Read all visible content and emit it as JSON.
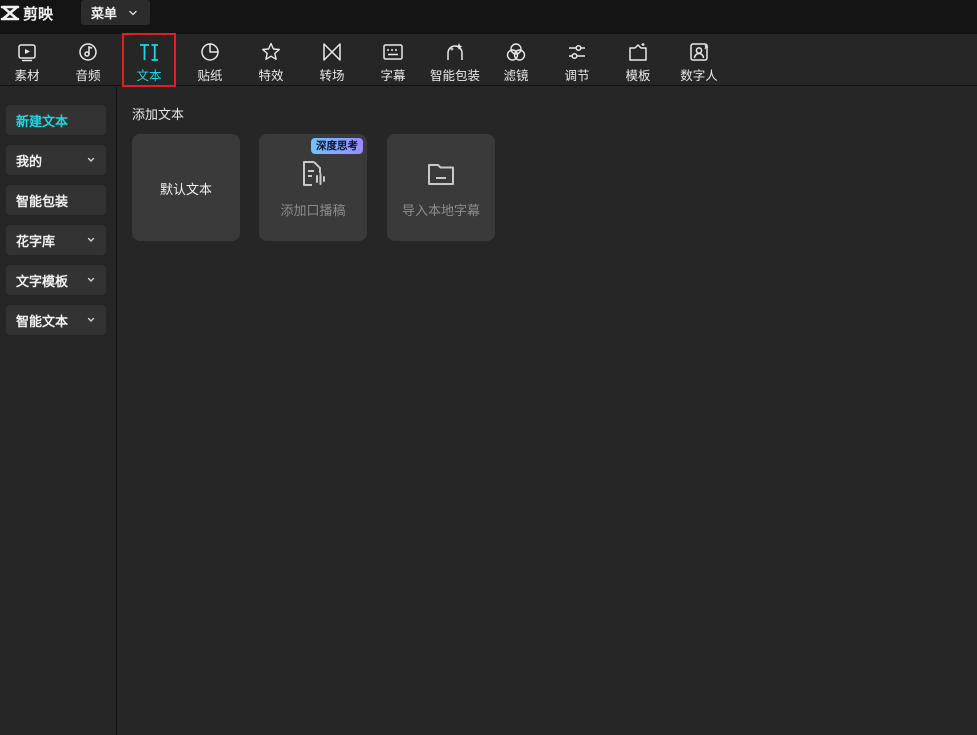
{
  "app": {
    "name": "剪映"
  },
  "menu": {
    "label": "菜单"
  },
  "toolbar": {
    "items": [
      {
        "label": "素材",
        "icon": "media-play-icon"
      },
      {
        "label": "音频",
        "icon": "audio-disc-icon"
      },
      {
        "label": "文本",
        "icon": "text-TI-icon",
        "active": true
      },
      {
        "label": "贴纸",
        "icon": "sticker-icon"
      },
      {
        "label": "特效",
        "icon": "effects-star-icon"
      },
      {
        "label": "转场",
        "icon": "transition-bowtie-icon"
      },
      {
        "label": "字幕",
        "icon": "subtitle-keyboard-icon"
      },
      {
        "label": "智能包装",
        "icon": "smart-package-sparkle-icon"
      },
      {
        "label": "滤镜",
        "icon": "filter-circles-icon"
      },
      {
        "label": "调节",
        "icon": "adjust-sliders-icon"
      },
      {
        "label": "模板",
        "icon": "template-icon"
      },
      {
        "label": "数字人",
        "icon": "digital-human-icon"
      }
    ]
  },
  "sidebar": {
    "items": [
      {
        "label": "新建文本",
        "active": true,
        "has_chevron": false
      },
      {
        "label": "我的",
        "has_chevron": true
      },
      {
        "label": "智能包装",
        "has_chevron": false
      },
      {
        "label": "花字库",
        "has_chevron": true
      },
      {
        "label": "文字模板",
        "has_chevron": true
      },
      {
        "label": "智能文本",
        "has_chevron": true
      }
    ]
  },
  "main": {
    "section_title": "添加文本",
    "cards": [
      {
        "label": "默认文本"
      },
      {
        "label": "添加口播稿",
        "badge": "深度思考",
        "icon": "script-mic-icon"
      },
      {
        "label": "导入本地字幕",
        "icon": "folder-icon"
      }
    ]
  },
  "colors": {
    "accent": "#1ed6e1",
    "highlight_border": "#e02020",
    "background": "#262626",
    "card": "#3a3a3a",
    "titlebar": "#141414"
  }
}
